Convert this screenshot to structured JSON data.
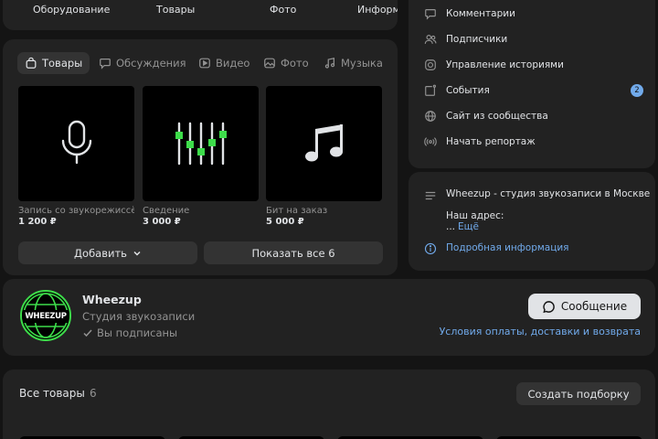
{
  "top_tabs": [
    "Оборудование",
    "Товары",
    "Фото",
    "Информ"
  ],
  "products": {
    "tabs": [
      {
        "label": "Товары",
        "icon": "shopping-bag-icon",
        "active": true
      },
      {
        "label": "Обсуждения",
        "icon": "chat-bubble-icon",
        "active": false
      },
      {
        "label": "Видео",
        "icon": "video-icon",
        "active": false
      },
      {
        "label": "Фото",
        "icon": "photo-icon",
        "active": false
      },
      {
        "label": "Музыка",
        "icon": "music-note-icon",
        "active": false
      }
    ],
    "items": [
      {
        "name": "Запись со звукорежиссёром",
        "price": "1 200 ₽",
        "icon": "microphone-icon"
      },
      {
        "name": "Сведение",
        "price": "3 000 ₽",
        "icon": "mixer-sliders-icon"
      },
      {
        "name": "Бит на заказ",
        "price": "5 000 ₽",
        "icon": "music-notes-icon"
      }
    ],
    "add_label": "Добавить",
    "show_all_label": "Показать все 6"
  },
  "menu": {
    "items": [
      {
        "label": "Комментарии",
        "icon": "comment-icon"
      },
      {
        "label": "Подписчики",
        "icon": "users-icon"
      },
      {
        "label": "Управление историями",
        "icon": "stories-icon"
      },
      {
        "label": "События",
        "icon": "calendar-icon",
        "badge": "2"
      },
      {
        "label": "Сайт из сообщества",
        "icon": "globe-icon"
      },
      {
        "label": "Начать репортаж",
        "icon": "broadcast-icon"
      }
    ]
  },
  "info": {
    "description": "Wheezup - студия звукозаписи в Москве",
    "address_label": "Наш адрес:",
    "more_prefix": "...",
    "more_link": "Ещё",
    "details_link": "Подробная информация"
  },
  "community": {
    "logo_text": "WHEEZUP",
    "name": "Wheezup",
    "subtitle": "Студия звукозаписи",
    "subscribed": "Вы подписаны",
    "message_button": "Сообщение",
    "terms_link": "Условия оплаты, доставки и возврата"
  },
  "goods": {
    "title": "Все товары",
    "count": "6",
    "create_button": "Создать подборку"
  },
  "colors": {
    "background": "#141414",
    "card": "#222222",
    "accent": "#71aaeb",
    "logo_green": "#3ddc4a"
  }
}
